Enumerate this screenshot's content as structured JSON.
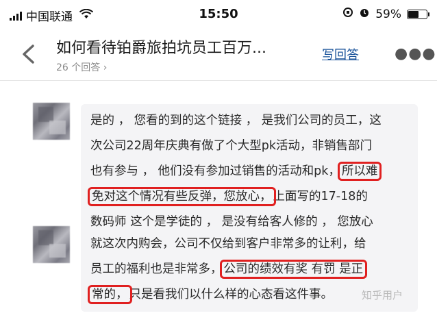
{
  "status_bar": {
    "carrier": "中国联通",
    "time": "15:50",
    "battery": "59%",
    "battery_level": 0.59
  },
  "nav": {
    "title": "如何看待铂爵旅拍坑员工百万...",
    "answer_count": "26 个回答 ›",
    "write_answer": "写回答"
  },
  "messages": [
    {
      "lines": [
        "是的 ， 您看的到的这个链接 ， 是我们公司的员工，这",
        "次公司22周年庆典有做了个大型pk活动，非销售部门",
        "也有参与 ， 他们没有参加过销售的活动和pk，",
        "所以难",
        "免对这个情况有些反弹，您放心，",
        "上面写的17-18的",
        "数码师 这个是学徒的 ， 是没有给客人修的 ， 您放心"
      ]
    },
    {
      "lines": [
        "就这次内购会，公司不仅给到客户非常多的让利，给",
        "员工的福利也是非常多，",
        "公司的绩效有奖 有罚 是正",
        "常的，",
        "只是看我们以什么样的心态看这件事。"
      ]
    }
  ],
  "watermark": "知乎用户",
  "colors": {
    "highlight_border": "#e02020",
    "link": "#175199",
    "bubble_bg": "#f4f4f6"
  }
}
